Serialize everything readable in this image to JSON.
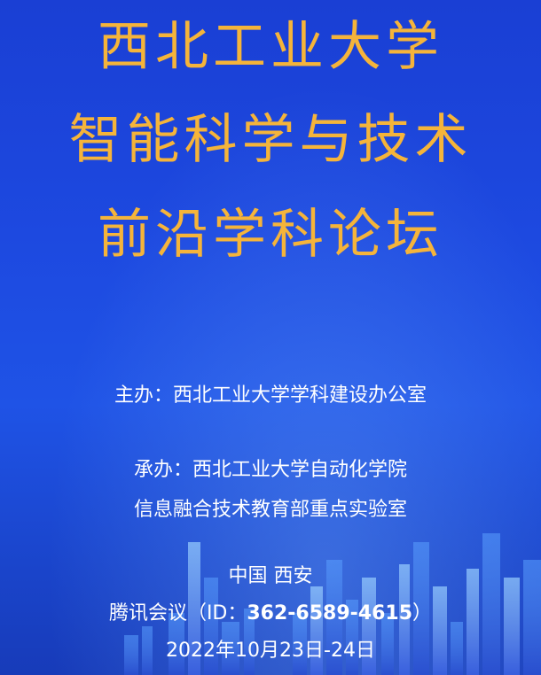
{
  "title": {
    "line1": "西北工业大学",
    "line2": "智能科学与技术",
    "line3": "前沿学科论坛"
  },
  "organizer": {
    "label": "主办：",
    "value": "西北工业大学学科建设办公室"
  },
  "coorganizer": {
    "label": "承办：",
    "value_line1": "西北工业大学自动化学院",
    "value_line2": "信息融合技术教育部重点实验室"
  },
  "location": "中国 西安",
  "meeting": {
    "prefix": "腾讯会议（ID：",
    "id": "362-6589-4615",
    "suffix": "）"
  },
  "date": "2022年10月23日-24日",
  "colors": {
    "background": "#1d49e0",
    "title": "#f5b43a",
    "text": "#ffffff"
  }
}
